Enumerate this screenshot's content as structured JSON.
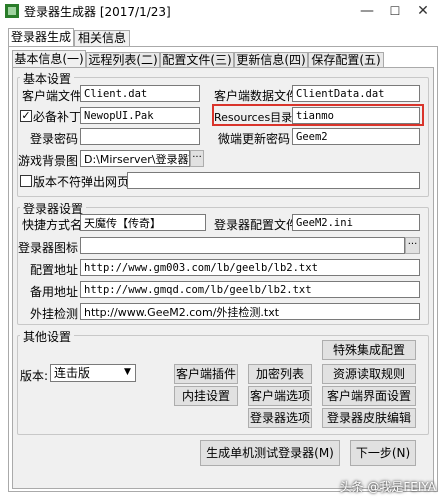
{
  "window": {
    "title": "登录器生成器 [2017/1/23]",
    "minimize": "—",
    "maximize": "☐",
    "close": "✕"
  },
  "outer_tabs": [
    "登录器生成",
    "相关信息"
  ],
  "inner_tabs": [
    "基本信息(一)",
    "远程列表(二)",
    "配置文件(三)",
    "更新信息(四)",
    "保存配置(五)"
  ],
  "basic": {
    "group_label": "基本设置",
    "client_file_label": "客户端文件",
    "client_file_value": "Client.dat",
    "client_data_label": "客户端数据文件",
    "client_data_value": "ClientData.dat",
    "patch_label": "必备补丁",
    "patch_checked": true,
    "patch_value": "NewopUI.Pak",
    "resources_label": "Resources目录",
    "resources_value": "tianmo",
    "login_pwd_label": "登录密码",
    "login_pwd_value": "",
    "micro_pwd_label": "微端更新密码",
    "micro_pwd_value": "Geem2",
    "bg_label": "游戏背景图",
    "bg_value": "D:\\Mirserver\\登录器\\",
    "no_popup_label": "版本不符弹出网页",
    "no_popup_checked": false,
    "no_popup_value": ""
  },
  "login": {
    "group_label": "登录器设置",
    "shortcut_label": "快捷方式名",
    "shortcut_value": "天魔传【传奇】",
    "config_label": "登录器配置文件",
    "config_value": "GeeM2.ini",
    "icon_label": "登录器图标",
    "icon_value": "",
    "config_addr_label": "配置地址",
    "config_addr_value": "http://www.gm003.com/lb/geelb/lb2.txt",
    "backup_addr_label": "备用地址",
    "backup_addr_value": "http://www.gmqd.com/lb/geelb/lb2.txt",
    "plugin_check_label": "外挂检测",
    "plugin_check_value": "http://www.GeeM2.com/外挂检测.txt"
  },
  "other": {
    "group_label": "其他设置",
    "version_label": "版本:",
    "version_value": "连击版",
    "buttons": {
      "special": "特殊集成配置",
      "client_plugin": "客户端插件",
      "encrypt_list": "加密列表",
      "resource_rule": "资源读取规则",
      "builtin": "内挂设置",
      "client_options": "客户端选项",
      "client_ui": "客户端界面设置",
      "login_options": "登录器选项",
      "login_skin": "登录器皮肤编辑"
    }
  },
  "footer": {
    "generate": "生成单机测试登录器(M)",
    "next": "下一步(N)"
  },
  "watermark": "头条 @我是FEIYA"
}
